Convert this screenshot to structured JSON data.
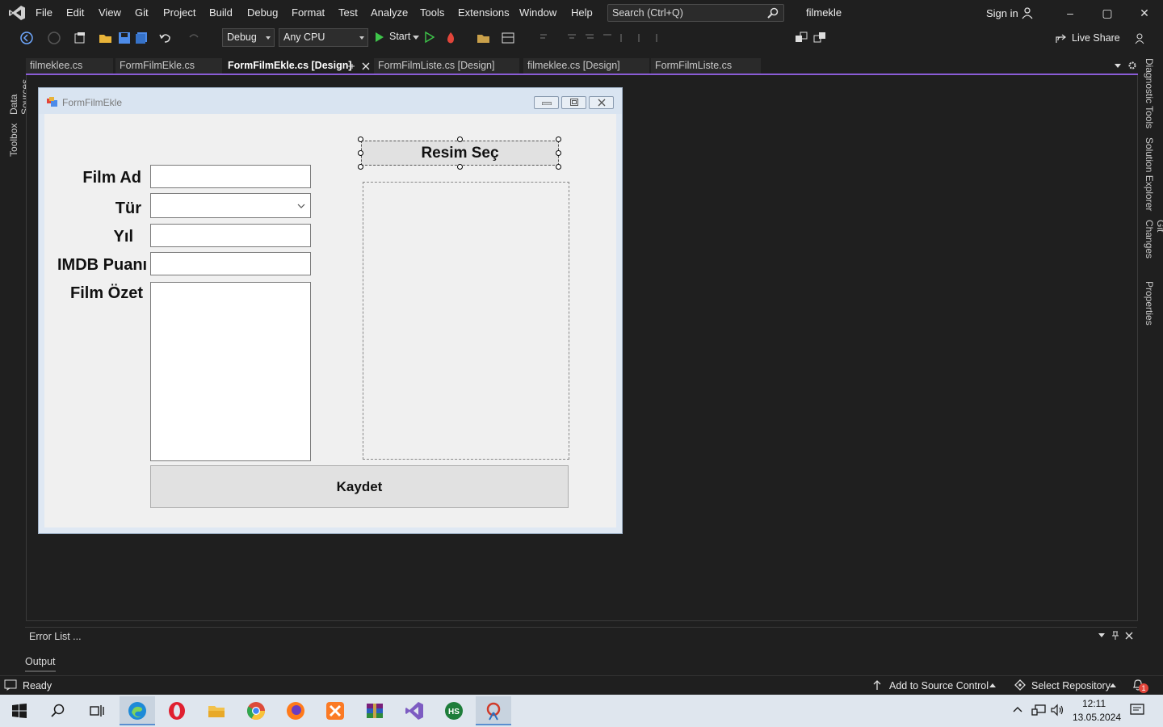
{
  "menu": {
    "items": [
      "File",
      "Edit",
      "View",
      "Git",
      "Project",
      "Build",
      "Debug",
      "Format",
      "Test",
      "Analyze",
      "Tools",
      "Extensions",
      "Window",
      "Help"
    ],
    "search_placeholder": "Search (Ctrl+Q)",
    "solution_name": "filmekle",
    "sign_in": "Sign in"
  },
  "toolbar": {
    "config": "Debug",
    "platform": "Any CPU",
    "start_label": "Start",
    "live_share": "Live Share"
  },
  "side_left": [
    "Data Sources",
    "Toolbox"
  ],
  "side_right": [
    "Diagnostic Tools",
    "Solution Explorer",
    "Git Changes",
    "Properties"
  ],
  "doc_tabs": [
    {
      "label": "filmeklee.cs",
      "active": false
    },
    {
      "label": "FormFilmEkle.cs",
      "active": false
    },
    {
      "label": "FormFilmEkle.cs [Design]",
      "active": true
    },
    {
      "label": "FormFilmListe.cs [Design]",
      "active": false
    },
    {
      "label": "filmeklee.cs [Design]",
      "active": false
    },
    {
      "label": "FormFilmListe.cs",
      "active": false
    }
  ],
  "form": {
    "title": "FormFilmEkle",
    "labels": {
      "film_ad": "Film Ad",
      "tur": "Tür",
      "yil": "Yıl",
      "imdb": "IMDB Puanı",
      "ozet": "Film Özet"
    },
    "buttons": {
      "resim_sec": "Resim Seç",
      "kaydet": "Kaydet"
    }
  },
  "panels": {
    "error_list": "Error List ...",
    "output": "Output"
  },
  "status": {
    "ready": "Ready",
    "source_control": "Add to Source Control",
    "repository": "Select Repository",
    "notifications": "1"
  },
  "taskbar": {
    "time": "12:11",
    "date": "13.05.2024"
  },
  "colors": {
    "accent": "#8a5cd6",
    "ide_bg": "#1f1f1f",
    "form_bg": "#f0f0f0"
  }
}
